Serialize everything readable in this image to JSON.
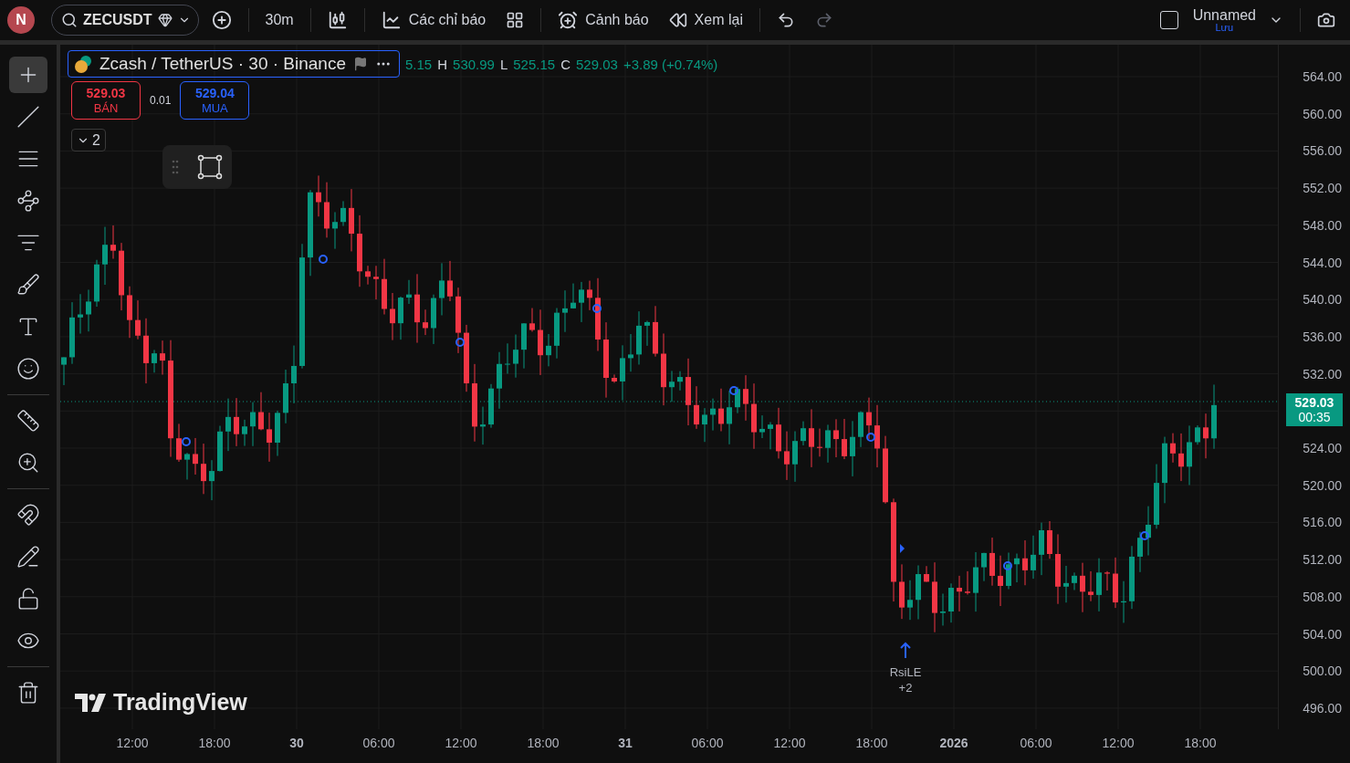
{
  "top_bar": {
    "avatar": "N",
    "symbol": "ZECUSDT",
    "interval": "30m",
    "indicators": "Các chỉ báo",
    "alerts": "Cảnh báo",
    "replay": "Xem lại",
    "undo": {
      "disabled": false
    },
    "redo": {
      "disabled": true
    },
    "layout_checkbox": {
      "checked": false
    },
    "layout": {
      "name": "Unnamed",
      "status": "Lưu"
    }
  },
  "tools": [
    [
      {
        "selected": true
      },
      {
        "selected": false
      },
      {
        "selected": false
      },
      {
        "selected": false
      },
      {
        "selected": false
      },
      {
        "selected": false
      },
      {
        "selected": false
      },
      {
        "selected": false
      }
    ],
    [
      {
        "selected": false
      },
      {
        "selected": false
      }
    ],
    [
      {
        "selected": false
      },
      {
        "selected": false
      },
      {
        "selected": false
      },
      {
        "selected": false
      }
    ],
    [
      {
        "selected": false
      }
    ]
  ],
  "legend": {
    "title": "Zcash / TetherUS · 30 · Binance",
    "open_partial": "5.15",
    "values": [
      {
        "label": "H",
        "value": "530.99"
      },
      {
        "label": "L",
        "value": "525.15"
      },
      {
        "label": "C",
        "value": "529.03"
      }
    ],
    "change": "+3.89 (+0.74%)"
  },
  "trade": {
    "sell": {
      "price": "529.03",
      "label": "BÁN"
    },
    "spread": "0.01",
    "buy": {
      "price": "529.04",
      "label": "MUA"
    }
  },
  "indicator_count": "2",
  "price_axis": {
    "labels": [
      "564.00",
      "560.00",
      "556.00",
      "552.00",
      "548.00",
      "544.00",
      "540.00",
      "536.00",
      "532.00",
      "524.00",
      "520.00",
      "516.00",
      "512.00",
      "508.00",
      "504.00",
      "500.00",
      "496.00"
    ],
    "last_price": "529.03",
    "countdown": "00:35"
  },
  "time_axis": [
    {
      "text": "12:00",
      "kind": "time"
    },
    {
      "text": "18:00",
      "kind": "time"
    },
    {
      "text": "30",
      "kind": "day"
    },
    {
      "text": "06:00",
      "kind": "time"
    },
    {
      "text": "12:00",
      "kind": "time"
    },
    {
      "text": "18:00",
      "kind": "time"
    },
    {
      "text": "31",
      "kind": "day"
    },
    {
      "text": "06:00",
      "kind": "time"
    },
    {
      "text": "12:00",
      "kind": "time"
    },
    {
      "text": "18:00",
      "kind": "time"
    },
    {
      "text": "2026",
      "kind": "year"
    },
    {
      "text": "06:00",
      "kind": "time"
    },
    {
      "text": "12:00",
      "kind": "time"
    },
    {
      "text": "18:00",
      "kind": "time"
    }
  ],
  "signal": {
    "name": "RsiLE",
    "count": "+2"
  },
  "logo": "TradingView"
}
